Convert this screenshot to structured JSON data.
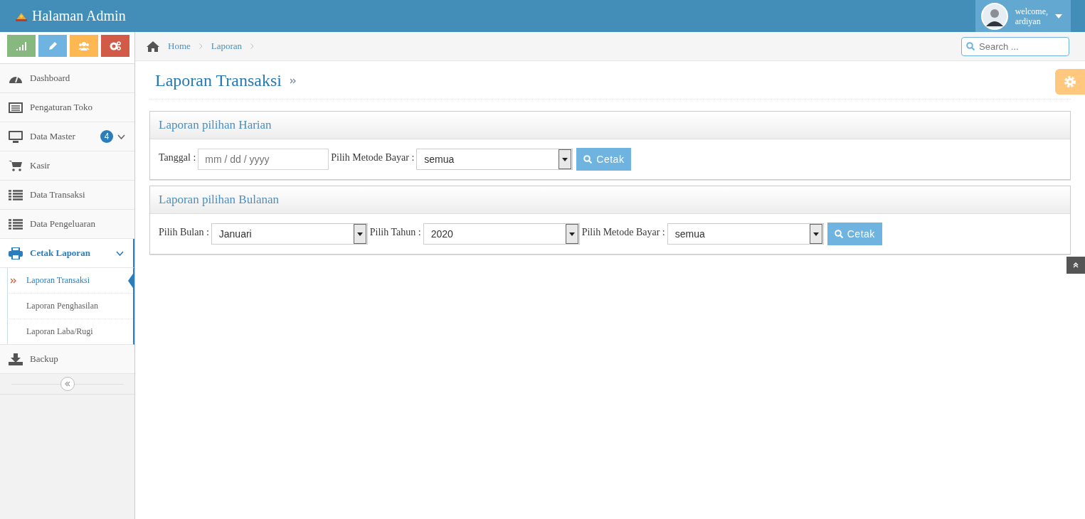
{
  "header": {
    "title": "Halaman Admin",
    "welcome": "welcome,",
    "user": "ardiyan"
  },
  "shortcuts": [
    {
      "kind": "chart",
      "color": "#87b87f"
    },
    {
      "kind": "pencil",
      "color": "#6fb3e0"
    },
    {
      "kind": "users",
      "color": "#ffb752"
    },
    {
      "kind": "gears",
      "color": "#d15b47"
    }
  ],
  "sidebar": {
    "items": [
      {
        "label": "Dashboard",
        "kind": "dashboard",
        "selected": false
      },
      {
        "label": "Pengaturan Toko",
        "kind": "card",
        "selected": false
      },
      {
        "label": "Data Master",
        "kind": "monitor",
        "selected": false,
        "badge": "4",
        "expanded": false
      },
      {
        "label": "Kasir",
        "kind": "cart",
        "selected": false
      },
      {
        "label": "Data Transaksi",
        "kind": "list",
        "selected": false
      },
      {
        "label": "Data Pengeluaran",
        "kind": "list",
        "selected": false
      },
      {
        "label": "Cetak Laporan",
        "kind": "printer",
        "selected": true,
        "expanded": true,
        "children": [
          {
            "label": "Laporan Transaksi",
            "selected": true
          },
          {
            "label": "Laporan Penghasilan",
            "selected": false
          },
          {
            "label": "Laporan Laba/Rugi",
            "selected": false
          }
        ]
      },
      {
        "label": "Backup",
        "kind": "download",
        "selected": false
      }
    ]
  },
  "breadcrumb": [
    "Home",
    "Laporan"
  ],
  "search": {
    "placeholder": "Search ..."
  },
  "page_title": "Laporan Transaksi",
  "panels": [
    {
      "title": "Laporan pilihan Harian",
      "fields": [
        {
          "kind": "date",
          "label": "Tanggal :",
          "placeholder": "mm / dd / yyyy"
        },
        {
          "kind": "select",
          "label": "Pilih Metode Bayar :",
          "value": "semua"
        }
      ],
      "button": "Cetak"
    },
    {
      "title": "Laporan pilihan Bulanan",
      "fields": [
        {
          "kind": "select",
          "label": "Pilih Bulan :",
          "value": "Januari"
        },
        {
          "kind": "select",
          "label": "Pilih Tahun :",
          "value": "2020"
        },
        {
          "kind": "select",
          "label": "Pilih Metode Bayar :",
          "value": "semua"
        }
      ],
      "button": "Cetak"
    }
  ]
}
